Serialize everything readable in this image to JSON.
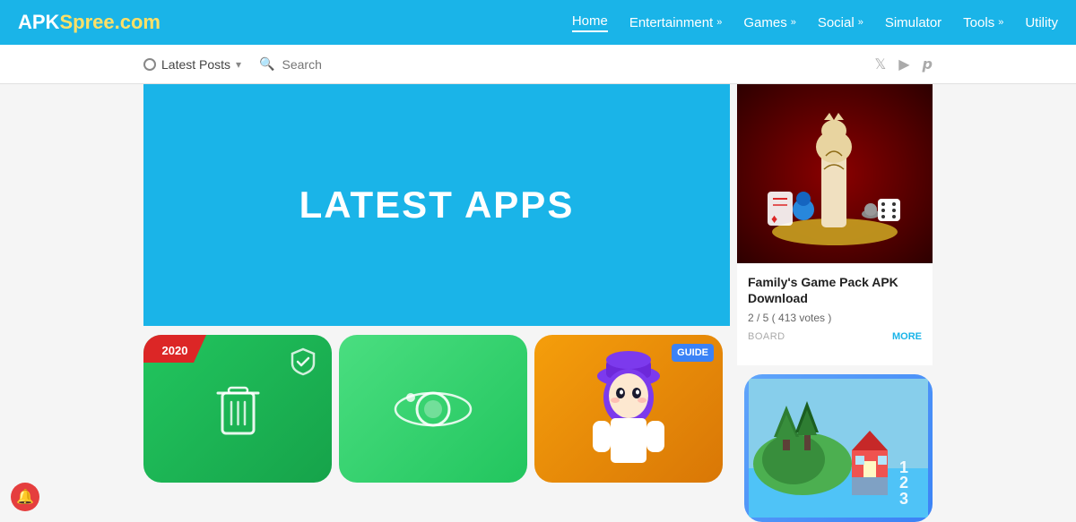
{
  "header": {
    "logo": "APKSpree.com",
    "logo_apk": "APK",
    "logo_spree": "Spree.com",
    "nav": [
      {
        "label": "Home",
        "active": true,
        "has_chevron": false
      },
      {
        "label": "Entertainment",
        "active": false,
        "has_chevron": true
      },
      {
        "label": "Games",
        "active": false,
        "has_chevron": true
      },
      {
        "label": "Social",
        "active": false,
        "has_chevron": true
      },
      {
        "label": "Simulator",
        "active": false,
        "has_chevron": false
      },
      {
        "label": "Tools",
        "active": false,
        "has_chevron": true
      },
      {
        "label": "Utility",
        "active": false,
        "has_chevron": false
      }
    ]
  },
  "subheader": {
    "latest_posts_label": "Latest Posts",
    "search_placeholder": "Search",
    "social": [
      "twitter",
      "youtube",
      "pinterest"
    ]
  },
  "hero": {
    "title": "LATEST APPS"
  },
  "sidebar_game": {
    "title": "Family's Game Pack APK Download",
    "rating": "2 / 5 ( 413 votes )",
    "category": "BOARD",
    "more_label": "MORE"
  },
  "apps": [
    {
      "id": "clean",
      "label": "2020",
      "type": "cleaner"
    },
    {
      "id": "orbit",
      "label": "",
      "type": "orbit"
    },
    {
      "id": "guide",
      "label": "GUIDE",
      "type": "guide"
    },
    {
      "id": "landscape",
      "label": "",
      "type": "landscape"
    }
  ],
  "notification": {
    "label": "🔔"
  }
}
